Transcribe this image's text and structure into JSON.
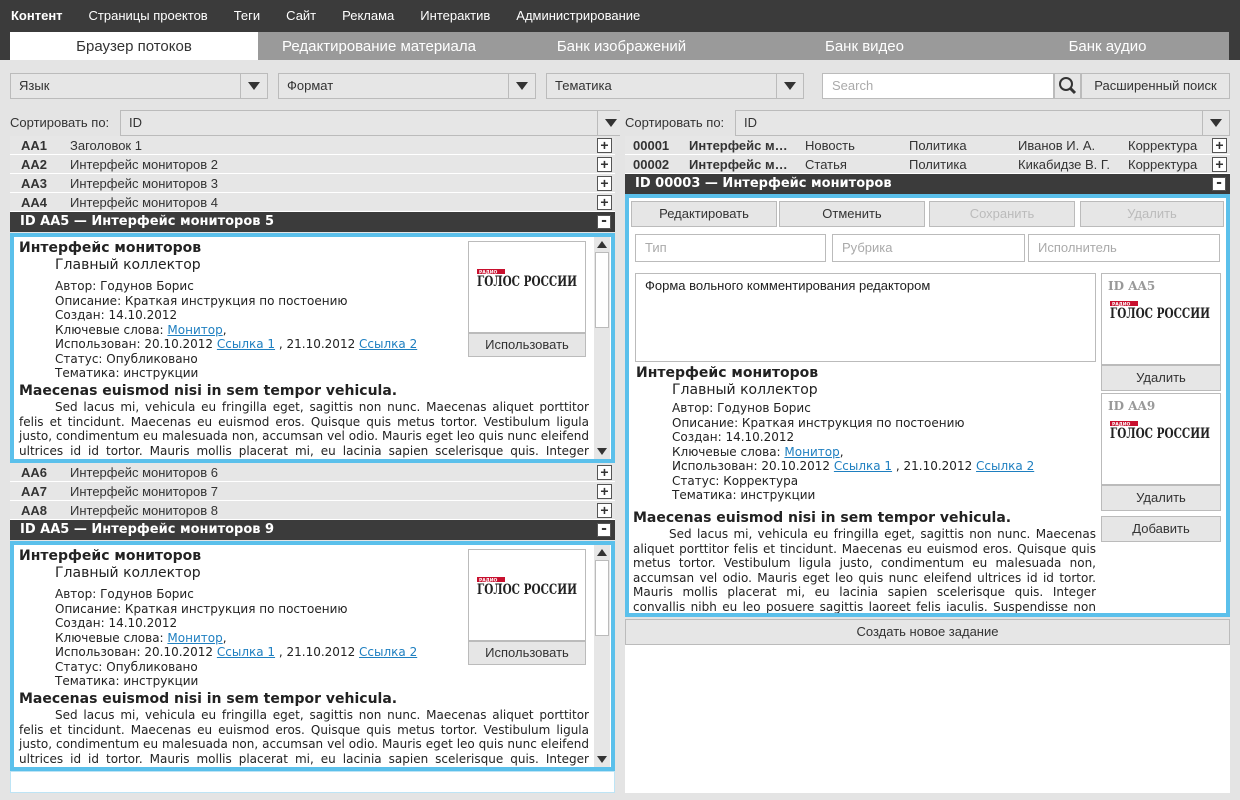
{
  "topnav": [
    "Контент",
    "Страницы проектов",
    "Теги",
    "Сайт",
    "Реклама",
    "Интерактив",
    "Администрирование"
  ],
  "tabs": [
    "Браузер потоков",
    "Редактирование материала",
    "Банк изображений",
    "Банк видео",
    "Банк аудио"
  ],
  "filters": {
    "lang": "Язык",
    "format": "Формат",
    "topic": "Тематика",
    "search_placeholder": "Search",
    "advanced": "Расширенный поиск"
  },
  "left": {
    "sort_label": "Сортировать по:",
    "sort_value": "ID",
    "rows_top": [
      {
        "id": "AA1",
        "title": "Заголовок 1"
      },
      {
        "id": "AA2",
        "title": "Интерфейс мониторов 2"
      },
      {
        "id": "AA3",
        "title": "Интерфейс мониторов 3"
      },
      {
        "id": "AA4",
        "title": "Интерфейс мониторов 4"
      }
    ],
    "expanded1": "ID AA5 — Интерфейс мониторов 5",
    "rows_mid": [
      {
        "id": "AA6",
        "title": "Интерфейс мониторов 6"
      },
      {
        "id": "AA7",
        "title": "Интерфейс мониторов 7"
      },
      {
        "id": "AA8",
        "title": "Интерфейс мониторов 8"
      }
    ],
    "expanded2": "ID AA5 — Интерфейс мониторов 9"
  },
  "card": {
    "title": "Интерфейс мониторов",
    "subtitle": "Главный коллектор",
    "author": "Автор: Годунов Борис",
    "description": "Описание: Краткая инструкция по постоению",
    "created": "Создан: 14.10.2012",
    "keywords_label": "Ключевые слова:",
    "keyword": "Монитор",
    "used_label": "Использован: 20.10.2012",
    "link1": "Ссылка 1",
    "used_date2": " , 21.10.2012",
    "link2": "Ссылка 2",
    "status": "Статус: Опубликовано",
    "topic": "Тематика: инструкции",
    "heading": "Maecenas euismod nisi in sem tempor vehicula.",
    "body": "Sed lacus mi, vehicula eu fringilla eget, sagittis non nunc. Maecenas aliquet porttitor felis et tincidunt. Maecenas eu euismod eros. Quisque quis metus tortor. Vestibulum ligula justo, condimentum eu malesuada non, accumsan vel odio. Mauris eget leo quis nunc eleifend ultrices id id tortor. Mauris mollis placerat mi, eu lacinia sapien scelerisque quis. Integer convallis nibh eu leo posuere sagittis laoreet felis iaculis. Suspendisse non tincidunt",
    "use_button": "Использовать",
    "logo_top": "РАДИО",
    "logo_main": "ГОЛОС РОССИИ"
  },
  "right": {
    "sort_label": "Сортировать по:",
    "sort_value": "ID",
    "rows": [
      {
        "id": "00001",
        "title": "Интерфейс м…",
        "type": "Новость",
        "rubric": "Политика",
        "person": "Иванов И. А.",
        "state": "Корректура"
      },
      {
        "id": "00002",
        "title": "Интерфейс м…",
        "type": "Статья",
        "rubric": "Политика",
        "person": "Кикабидзе В. Г.",
        "state": "Корректура"
      }
    ],
    "expanded": "ID 00003 — Интерфейс мониторов",
    "buttons": {
      "edit": "Редактировать",
      "cancel": "Отменить",
      "save": "Сохранить",
      "delete": "Удалить"
    },
    "fields": {
      "type": "Тип",
      "rubric": "Рубрика",
      "executor": "Исполнитель"
    },
    "comment": "Форма вольного комментирования редактором",
    "status": "Статус: Корректура",
    "images": [
      {
        "id": "ID AA5",
        "delete": "Удалить"
      },
      {
        "id": "ID AA9",
        "delete": "Удалить"
      }
    ],
    "add": "Добавить",
    "new_task": "Создать новое задание"
  },
  "colors": {
    "dark": "#3b3b3b",
    "accent": "#5bc0eb",
    "panel": "#e4e4e4",
    "link": "#1e7fc0"
  }
}
